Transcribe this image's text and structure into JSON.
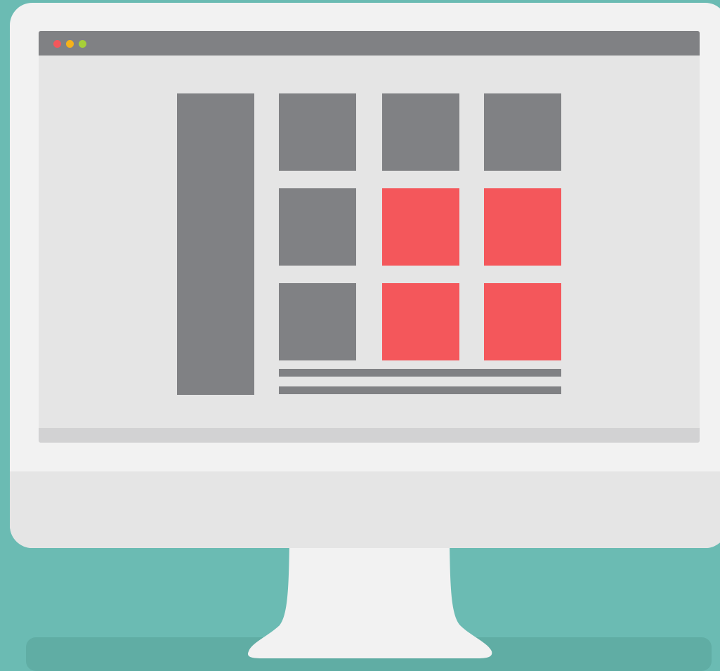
{
  "illustration": {
    "subject": "desktop-monitor-grid-layout",
    "colors": {
      "background": "#6bbbb3",
      "monitor_frame": "#f2f2f2",
      "screen": "#e5e5e5",
      "titlebar": "#808184",
      "block_gray": "#808184",
      "block_red": "#f4575b",
      "statusbar": "#d2d2d3"
    },
    "window_controls": [
      {
        "name": "close",
        "color": "#f4575b"
      },
      {
        "name": "minimize",
        "color": "#f6b21a"
      },
      {
        "name": "maximize",
        "color": "#a7cf38"
      }
    ],
    "grid": {
      "rows": 3,
      "columns": 3,
      "highlighted_count": 4
    }
  }
}
